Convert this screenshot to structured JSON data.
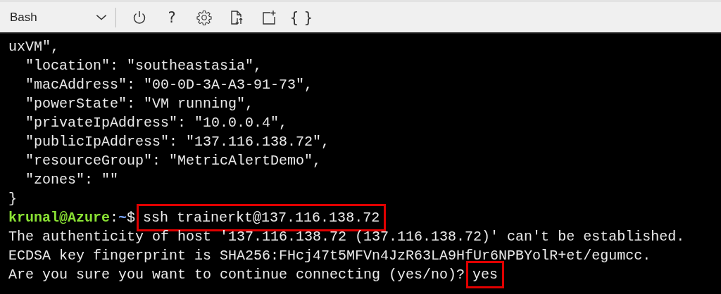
{
  "toolbar": {
    "shell_selector": {
      "value": "Bash"
    },
    "buttons": [
      {
        "kind": "power"
      },
      {
        "kind": "glyph",
        "text": "?"
      },
      {
        "kind": "settings"
      },
      {
        "kind": "upload"
      },
      {
        "kind": "new"
      },
      {
        "kind": "glyph",
        "text": "{ }"
      }
    ]
  },
  "terminal": {
    "lines": [
      [
        {
          "kind": "output",
          "text": "uxVM\","
        }
      ],
      [
        {
          "kind": "output",
          "text": "  \"location\": \"southeastasia\","
        }
      ],
      [
        {
          "kind": "output",
          "text": "  \"macAddress\": \"00-0D-3A-A3-91-73\","
        }
      ],
      [
        {
          "kind": "output",
          "text": "  \"powerState\": \"VM running\","
        }
      ],
      [
        {
          "kind": "output",
          "text": "  \"privateIpAddress\": \"10.0.0.4\","
        }
      ],
      [
        {
          "kind": "output",
          "text": "  \"publicIpAddress\": \"137.116.138.72\","
        }
      ],
      [
        {
          "kind": "output",
          "text": "  \"resourceGroup\": \"MetricAlertDemo\","
        }
      ],
      [
        {
          "kind": "output",
          "text": "  \"zones\": \"\""
        }
      ],
      [
        {
          "kind": "output",
          "text": "}"
        }
      ],
      [
        {
          "kind": "user",
          "text": "krunal@Azure"
        },
        {
          "kind": "output",
          "text": ":"
        },
        {
          "kind": "path",
          "text": "~"
        },
        {
          "kind": "output",
          "text": "$"
        },
        {
          "kind": "command",
          "text": "ssh trainerkt@137.116.138.72",
          "highlighted": true
        }
      ],
      [
        {
          "kind": "output",
          "text": "The authenticity of host '137.116.138.72 (137.116.138.72)' can't be established."
        }
      ],
      [
        {
          "kind": "output",
          "text": "ECDSA key fingerprint is SHA256:FHcj47t5MFVn4JzR63LA9HfUr6NPBYolR+et/egumcc."
        }
      ],
      [
        {
          "kind": "output",
          "text": "Are you sure you want to continue connecting (yes/no)?"
        },
        {
          "kind": "command",
          "text": "yes",
          "highlighted": true
        }
      ]
    ]
  }
}
